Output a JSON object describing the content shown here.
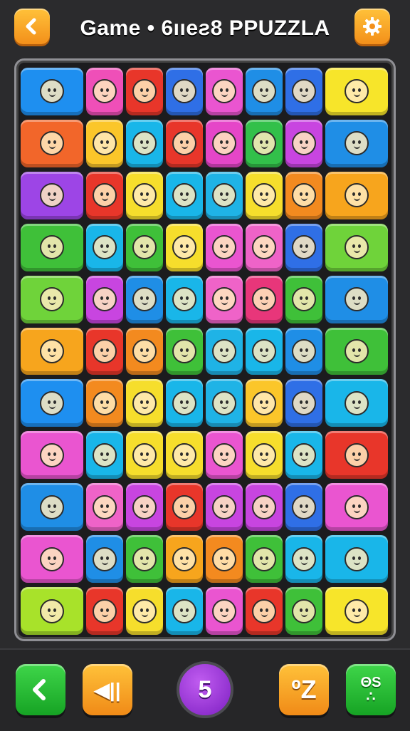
{
  "header": {
    "title": "Game • 6ııeƨ8 PPUZZLA",
    "back_icon": "chevron-left-icon",
    "settings_icon": "gear-icon",
    "accent": "#f7a51d"
  },
  "board": {
    "rows": 11,
    "cols": 8,
    "tiles": [
      [
        "#1e8ff0",
        "#ef4fb8",
        "#e8362a",
        "#2f6fe6",
        "#ea55d0",
        "#1f8ee6",
        "#2f6fe6",
        "#f7e52a"
      ],
      [
        "#f2662a",
        "#fbc62a",
        "#19b6e9",
        "#e8362a",
        "#e546c8",
        "#32c04a",
        "#c845e0",
        "#1f8ee6"
      ],
      [
        "#9d45e6",
        "#e8362a",
        "#f6de2c",
        "#19b6e9",
        "#1fb3e6",
        "#f6de2c",
        "#f38a1f",
        "#f7a51d"
      ],
      [
        "#3fc039",
        "#19b6e9",
        "#3fc039",
        "#f6de2c",
        "#ea55d0",
        "#ef63c8",
        "#2f6fe6",
        "#6fd33a"
      ],
      [
        "#6fd33a",
        "#c845e0",
        "#1f8ee6",
        "#19b6e9",
        "#ef63c8",
        "#e8367a",
        "#3fc039",
        "#1f8ee6"
      ],
      [
        "#f7a51d",
        "#e8362a",
        "#f38a1f",
        "#3fc039",
        "#1fb3e6",
        "#19b6e9",
        "#1f8ee6",
        "#3fc039"
      ],
      [
        "#1e8ff0",
        "#f38a1f",
        "#f6de2c",
        "#19b6e9",
        "#1fb3e6",
        "#fbc62a",
        "#2f6fe6",
        "#19b6e9"
      ],
      [
        "#ea55d0",
        "#19b6e9",
        "#f6de2c",
        "#f6de2c",
        "#ea55d0",
        "#f6de2c",
        "#19b6e9",
        "#e8362a"
      ],
      [
        "#1f8ee6",
        "#ef63c8",
        "#c845e0",
        "#e8362a",
        "#c845e0",
        "#c845e0",
        "#2f6fe6",
        "#ea55d0"
      ],
      [
        "#ea55d0",
        "#1f8ee6",
        "#3fc039",
        "#f7a51d",
        "#f38a1f",
        "#3fc039",
        "#19b6e9",
        "#19b6e9"
      ],
      [
        "#a8e22a",
        "#e8362a",
        "#f6de2c",
        "#19b6e9",
        "#ea55d0",
        "#e8362a",
        "#3fc039",
        "#f7e52a"
      ]
    ]
  },
  "controls": {
    "prev_icon": "chevron-left-icon",
    "sound_label": "◀||",
    "moves_counter": "5",
    "hint_label": "ºZ",
    "grid_label": "ΘS\n∴"
  }
}
